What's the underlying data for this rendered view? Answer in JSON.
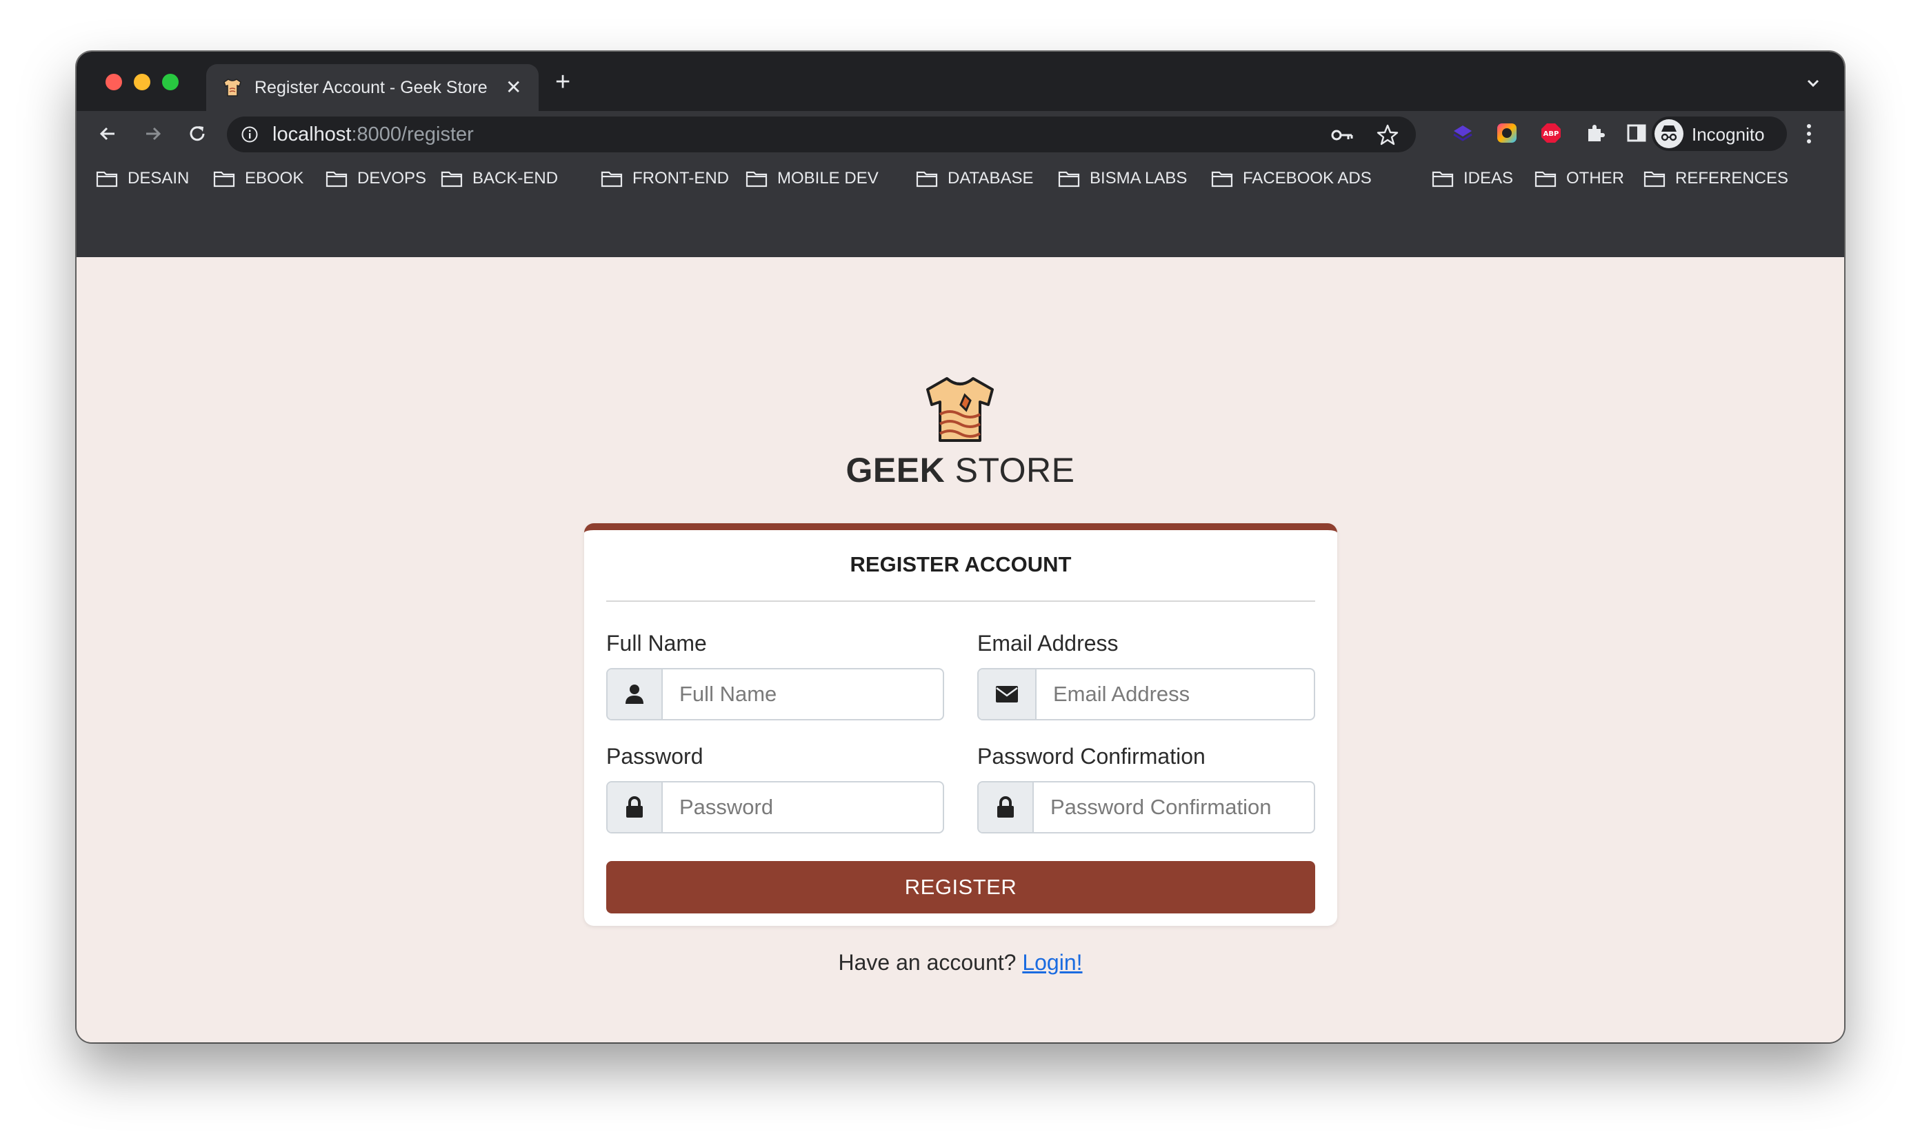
{
  "browser": {
    "tab_title": "Register Account - Geek Store",
    "url_host": "localhost",
    "url_path": ":8000/register",
    "profile_label": "Incognito",
    "bookmarks": [
      "DESAIN",
      "EBOOK",
      "DEVOPS",
      "BACK-END",
      "FRONT-END",
      "MOBILE DEV",
      "DATABASE",
      "BISMA LABS",
      "FACEBOOK ADS",
      "IDEAS",
      "OTHER",
      "REFERENCES"
    ]
  },
  "brand": {
    "bold": "GEEK",
    "regular": "STORE"
  },
  "form": {
    "title": "REGISTER ACCOUNT",
    "full_name": {
      "label": "Full Name",
      "placeholder": "Full Name",
      "icon": "user-icon"
    },
    "email": {
      "label": "Email Address",
      "placeholder": "Email Address",
      "icon": "envelope-icon"
    },
    "password": {
      "label": "Password",
      "placeholder": "Password",
      "icon": "lock-icon"
    },
    "password_confirmation": {
      "label": "Password Confirmation",
      "placeholder": "Password Confirmation",
      "icon": "lock-icon"
    },
    "submit_label": "REGISTER"
  },
  "footer": {
    "prompt": "Have an account?",
    "link_label": "Login!"
  },
  "colors": {
    "accent": "#8e3f2f",
    "page_bg": "#f4ebe8",
    "link": "#1a6be0"
  }
}
